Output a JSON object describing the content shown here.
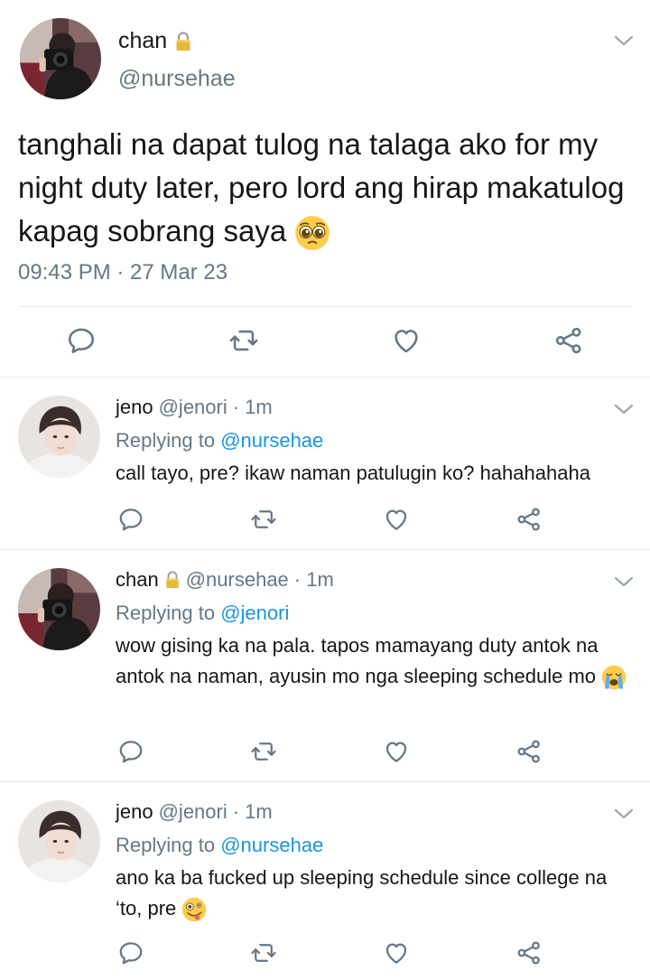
{
  "main_tweet": {
    "display_name": "chan",
    "handle": "@nursehae",
    "text": "tanghali na dapat tulog na talaga ako for my night duty later, pero lord ang hirap makatulog kapag sobrang saya",
    "emoji": "pleading-face",
    "timestamp": "09:43 PM · 27 Mar 23",
    "actions": [
      "reply-icon",
      "retweet-icon",
      "like-icon",
      "share-icon"
    ]
  },
  "replies": [
    {
      "display_name": "jeno",
      "handle": "@jenori",
      "time": "· 1m",
      "replying_prefix": "Replying to",
      "replying_to": "@nursehae",
      "text": "call tayo, pre? ikaw naman patulugin ko? hahahahaha",
      "emoji": ""
    },
    {
      "display_name": "chan",
      "handle": "@nursehae",
      "time": "· 1m",
      "replying_prefix": "Replying to",
      "replying_to": "@jenori",
      "text": "wow gising ka na pala. tapos mamayang duty antok na antok na naman, ayusin mo nga sleeping schedule mo",
      "emoji": "crying-face"
    },
    {
      "display_name": "jeno",
      "handle": "@jenori",
      "time": "· 1m",
      "replying_prefix": "Replying to",
      "replying_to": "@nursehae",
      "text": "ano ka ba fucked up sleeping schedule since college na ‘to, pre",
      "emoji": "zany-face"
    }
  ],
  "colors": {
    "text": "#14171a",
    "muted": "#657786",
    "link": "#1b95e0",
    "divider": "#e1e8ed"
  }
}
